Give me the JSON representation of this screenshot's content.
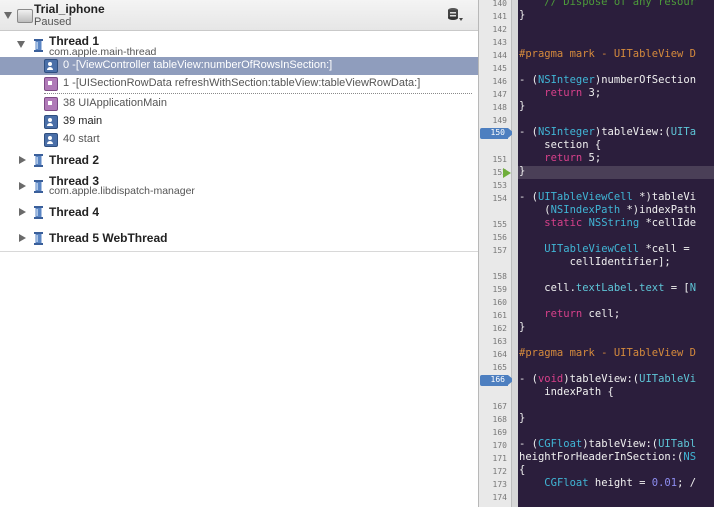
{
  "process": {
    "name": "Trial_iphone",
    "status": "Paused"
  },
  "threads": [
    {
      "title": "Thread 1",
      "subtitle": "com.apple.main-thread"
    },
    {
      "title": "Thread 2"
    },
    {
      "title": "Thread 3",
      "subtitle": "com.apple.libdispatch-manager"
    },
    {
      "title": "Thread 4"
    },
    {
      "title": "Thread 5 WebThread"
    }
  ],
  "frames": [
    {
      "text": "0 -[ViewController tableView:numberOfRowsInSection:]",
      "kind": "user-icon",
      "selected": true
    },
    {
      "text": "1 -[UISectionRowData refreshWithSection:tableView:tableViewRowData:]",
      "kind": "system-icon"
    },
    {
      "text": "38 UIApplicationMain",
      "kind": "system-icon"
    },
    {
      "text": "39 main",
      "kind": "user-icon"
    },
    {
      "text": "40 start",
      "kind": "user-icon"
    }
  ],
  "editor": {
    "breakpoints": [
      "150",
      "166"
    ],
    "line_numbers": [
      "140",
      "141",
      "142",
      "143",
      "144",
      "145",
      "146",
      "147",
      "148",
      "149",
      "150",
      "151",
      "152",
      "153",
      "154",
      "155",
      "156",
      "157",
      "158",
      "159",
      "160",
      "161",
      "162",
      "163",
      "164",
      "165",
      "166",
      "167",
      "168",
      "169",
      "170",
      "171",
      "172",
      "173",
      "174"
    ],
    "code": {
      "l140": "    // Dispose of any resour",
      "l141": "}",
      "l144": "#pragma mark - UITableView D",
      "l146_a": "- (",
      "l146_b": "NSInteger",
      "l146_c": ")numberOfSection",
      "l147_a": "    ",
      "l147_b": "return",
      "l147_c": " 3;",
      "l148": "}",
      "l150_a": "- (",
      "l150_b": "NSInteger",
      "l150_c": ")tableView:(",
      "l150_d": "UITa",
      "l150e": "    section {",
      "l151_a": "    ",
      "l151_b": "return",
      "l151_c": " 5;",
      "l152": "}",
      "l154_a": "- (",
      "l154_b": "UITableViewCell",
      "l154_c": " *)tableVi",
      "l154e_a": "    (",
      "l154e_b": "NSIndexPath",
      "l154e_c": " *)indexPath",
      "l155_a": "    ",
      "l155_b": "static",
      "l155_c": " ",
      "l155_d": "NSString",
      "l155_e": " *cellIde",
      "l157_a": "    ",
      "l157_b": "UITableViewCell",
      "l157_c": " *cell =",
      "l157e": "        cellIdentifier];",
      "l159_a": "    cell.",
      "l159_b": "textLabel",
      "l159_c": ".",
      "l159_d": "text",
      "l159_e": " = [",
      "l159_f": "N",
      "l161_a": "    ",
      "l161_b": "return",
      "l161_c": " cell;",
      "l162": "}",
      "l164": "#pragma mark - UITableView D",
      "l166_a": "- (",
      "l166_b": "void",
      "l166_c": ")tableView:(",
      "l166_d": "UITableVi",
      "l166e": "    indexPath {",
      "l168": "}",
      "l170_a": "- (",
      "l170_b": "CGFloat",
      "l170_c": ")tableView:(",
      "l170_d": "UITabl",
      "l171_a": "heightForHeaderInSection:(",
      "l171_b": "NS",
      "l172": "{",
      "l173_a": "    ",
      "l173_b": "CGFloat",
      "l173_c": " height = ",
      "l173_d": "0.01",
      "l173_e": "; /"
    }
  },
  "colors": {
    "editor_bg": "#2b1e3c",
    "selection": "#8f9dbd",
    "breakpoint": "#4d7fc0",
    "pc_arrow": "#6fae3a"
  }
}
